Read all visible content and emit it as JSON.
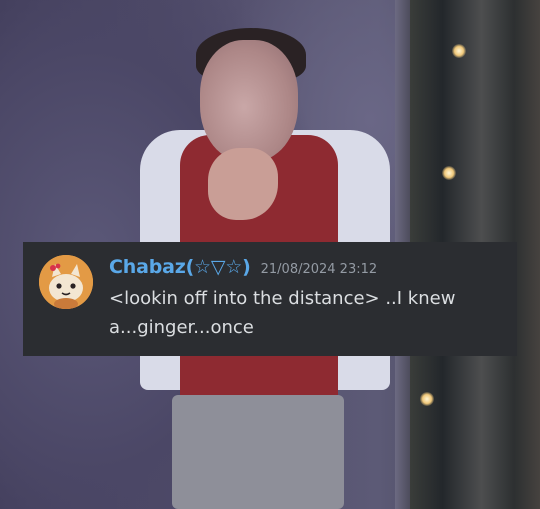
{
  "message": {
    "author": "Chabaz(☆▽☆)",
    "timestamp": "21/08/2024 23:12",
    "content": "<lookin off into the distance> ..I knew a...ginger...once",
    "avatar_icon": "cat-avatar-icon"
  },
  "colors": {
    "message_background": "#2b2d31",
    "username": "#5aa8e8",
    "timestamp": "#949ba4",
    "text": "#dbdee1"
  }
}
